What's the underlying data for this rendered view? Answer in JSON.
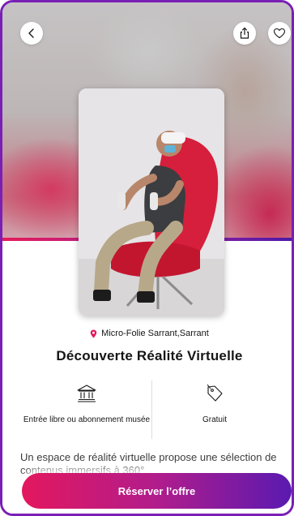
{
  "header": {
    "back_icon": "chevron-left-icon",
    "share_icon": "share-icon",
    "favorite_icon": "heart-icon"
  },
  "offer": {
    "venue": "Micro-Folie Sarrant,Sarrant",
    "title": "Découverte Réalité Virtuelle",
    "access_label": "Entrée libre ou abonnement musée",
    "price_label": "Gratuit",
    "description": "Un espace de réalité virtuelle propose une sélection de contenus immersifs à 360°"
  },
  "cta": {
    "label": "Réserver l’offre"
  },
  "colors": {
    "brand_pink": "#e3185e",
    "brand_purple": "#5a1ab0"
  }
}
